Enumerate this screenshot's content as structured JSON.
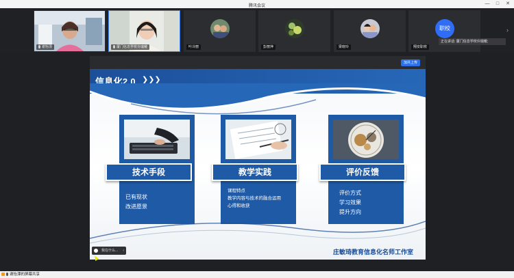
{
  "window": {
    "title": "腾讯会议",
    "minimize": "—",
    "maximize": "□",
    "close": "✕"
  },
  "participants": [
    {
      "name": "谢怡漂",
      "type": "video",
      "active": false
    },
    {
      "name": "厦门信息学校许瑞耀",
      "type": "video",
      "active": true
    },
    {
      "name": "叶冷丽",
      "type": "avatar"
    },
    {
      "name": "彭丽萍",
      "type": "avatar"
    },
    {
      "name": "梁晓玲",
      "type": "avatar"
    },
    {
      "name": "翔安职校",
      "type": "avatar-text",
      "avatar_text": "职校"
    }
  ],
  "strip": {
    "next_arrow": "›",
    "speaking": "正在讲话: 厦门信息学校许瑞耀;"
  },
  "share": {
    "button_label": "加共上传"
  },
  "slide": {
    "title": "信息化2.0",
    "chevrons": "❯❯❯",
    "cards": [
      {
        "label": "技术手段",
        "items": [
          "已有现状",
          "改进愿景"
        ]
      },
      {
        "label": "教学实践",
        "items": [
          "课程特点",
          "教学内容与技术的融合运用",
          "心得和收获"
        ]
      },
      {
        "label": "评价反馈",
        "items": [
          "评价方式",
          "学习效果",
          "提升方向"
        ]
      }
    ],
    "footer": "庄敏琦教育信息化名师工作室"
  },
  "float_toolbar": {
    "label": "我在什么...",
    "close": "‹"
  },
  "status": {
    "label": "谢怡漂的屏幕共享"
  },
  "colors": {
    "accent": "#1f5aa6",
    "active_border": "#3f83f8",
    "avatar_blue": "#2f6df6"
  }
}
